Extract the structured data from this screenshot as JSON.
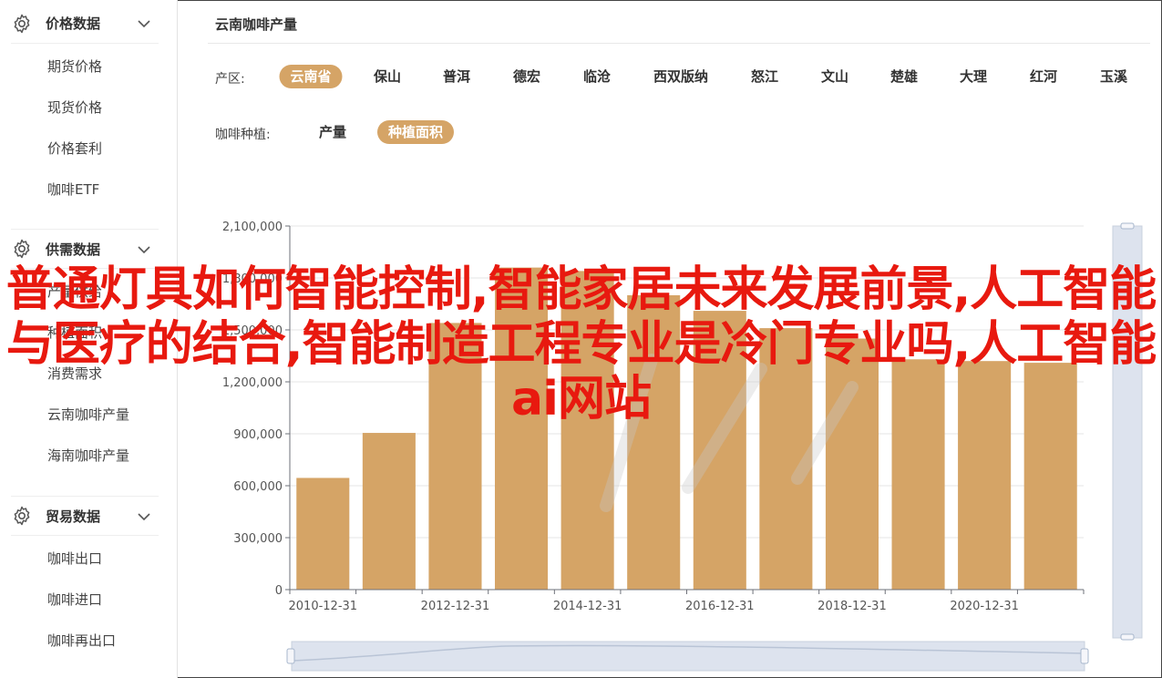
{
  "sidebar": {
    "groups": [
      {
        "title": "价格数据",
        "items": [
          "期货价格",
          "现货价格",
          "价格套利",
          "咖啡ETF"
        ]
      },
      {
        "title": "供需数据",
        "items": [
          "产量供给",
          "种植面积",
          "消费需求",
          "云南咖啡产量",
          "海南咖啡产量"
        ]
      },
      {
        "title": "贸易数据",
        "items": [
          "咖啡出口",
          "咖啡进口",
          "咖啡再出口"
        ]
      }
    ]
  },
  "main": {
    "title": "云南咖啡产量",
    "region_label": "产区:",
    "regions": [
      "云南省",
      "保山",
      "普洱",
      "德宏",
      "临沧",
      "西双版纳",
      "怒江",
      "文山",
      "楚雄",
      "大理",
      "红河",
      "玉溪"
    ],
    "region_active": "云南省",
    "variety_label": "咖啡种植:",
    "varieties": [
      "产量",
      "种植面积"
    ],
    "variety_active": "种植面积"
  },
  "chart_data": {
    "type": "bar",
    "x": [
      "2010-12-31",
      "2011-12-31",
      "2012-12-31",
      "2013-12-31",
      "2014-12-31",
      "2015-12-31",
      "2016-12-31",
      "2017-12-31",
      "2018-12-31",
      "2019-12-31",
      "2020-12-31",
      "2021-12-31"
    ],
    "x_tick_labels": [
      "2010-12-31",
      "2012-12-31",
      "2014-12-31",
      "2016-12-31",
      "2018-12-31",
      "2020-12-31"
    ],
    "values": [
      645000,
      905000,
      1540000,
      1860000,
      1840000,
      1700000,
      1610000,
      1510000,
      1450000,
      1330000,
      1320000,
      1310000
    ],
    "y_ticks": [
      "0",
      "300,000",
      "600,000",
      "900,000",
      "1,200,000",
      "1,500,000",
      "1,800,000",
      "2,100,000"
    ],
    "ylim": [
      0,
      2100000
    ],
    "bar_color": "#d5a466",
    "grid": true
  },
  "overlay_text": "普通灯具如何智能控制,智能家居未来发展前景,人工智能与医疗的结合,智能制造工程专业是冷门专业吗,人工智能ai网站",
  "colors": {
    "accent": "#d5a466",
    "overlay": "#e8190f",
    "axis": "#6e7079"
  }
}
